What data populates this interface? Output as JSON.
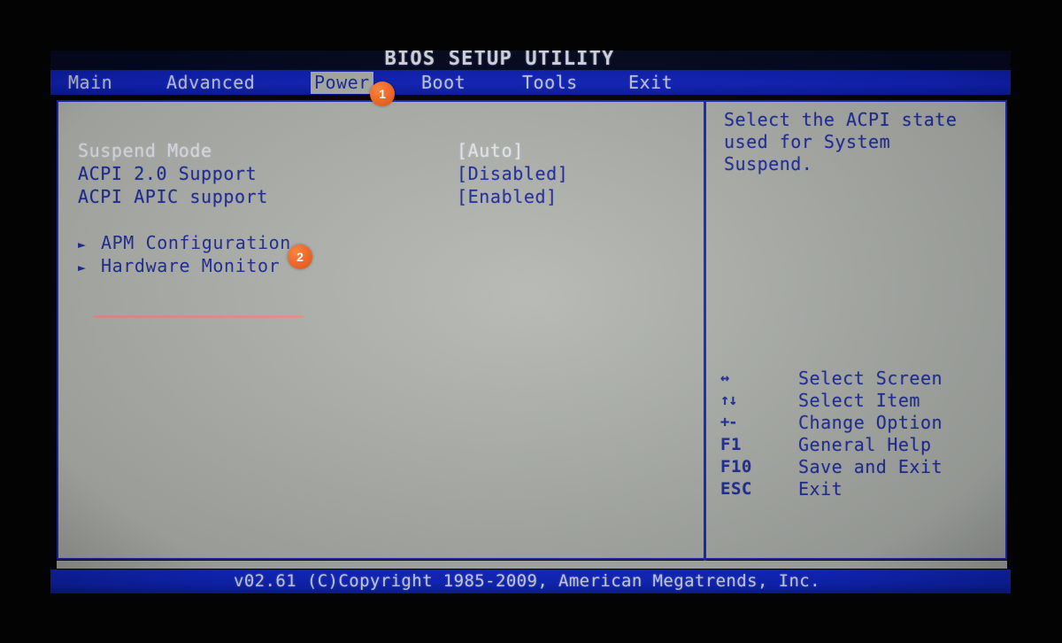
{
  "window": {
    "title": "BIOS SETUP UTILITY"
  },
  "menubar": {
    "items": [
      {
        "label": "Main",
        "active": false
      },
      {
        "label": "Advanced",
        "active": false
      },
      {
        "label": "Power",
        "active": true
      },
      {
        "label": "Boot",
        "active": false
      },
      {
        "label": "Tools",
        "active": false
      },
      {
        "label": "Exit",
        "active": false
      }
    ]
  },
  "settings": [
    {
      "name": "Suspend Mode",
      "value": "[Auto]",
      "selected": true
    },
    {
      "name": "ACPI 2.0 Support",
      "value": "[Disabled]",
      "selected": false
    },
    {
      "name": "ACPI APIC support",
      "value": "[Enabled]",
      "selected": false
    }
  ],
  "submenus": [
    {
      "arrow": "►",
      "label": "APM Configuration"
    },
    {
      "arrow": "►",
      "label": "Hardware Monitor"
    }
  ],
  "help": {
    "description": "Select the ACPI state used for System Suspend."
  },
  "legend": [
    {
      "key": "↔",
      "desc": "Select Screen"
    },
    {
      "key": "↑↓",
      "desc": "Select Item"
    },
    {
      "key": "+-",
      "desc": "Change Option"
    },
    {
      "key": "F1",
      "desc": "General Help"
    },
    {
      "key": "F10",
      "desc": "Save and Exit"
    },
    {
      "key": "ESC",
      "desc": "Exit"
    }
  ],
  "footer": {
    "copyright": "v02.61 (C)Copyright 1985-2009, American Megatrends, Inc."
  },
  "annotations": [
    {
      "label": "1",
      "target": "power-tab"
    },
    {
      "label": "2",
      "target": "hardware-monitor"
    }
  ],
  "colors": {
    "menu_blue": "#1023b8",
    "panel_gray": "#b7bab5",
    "text_blue": "#23309e",
    "badge_orange": "#ee6a2c",
    "underline_pink": "#ef9a94"
  }
}
